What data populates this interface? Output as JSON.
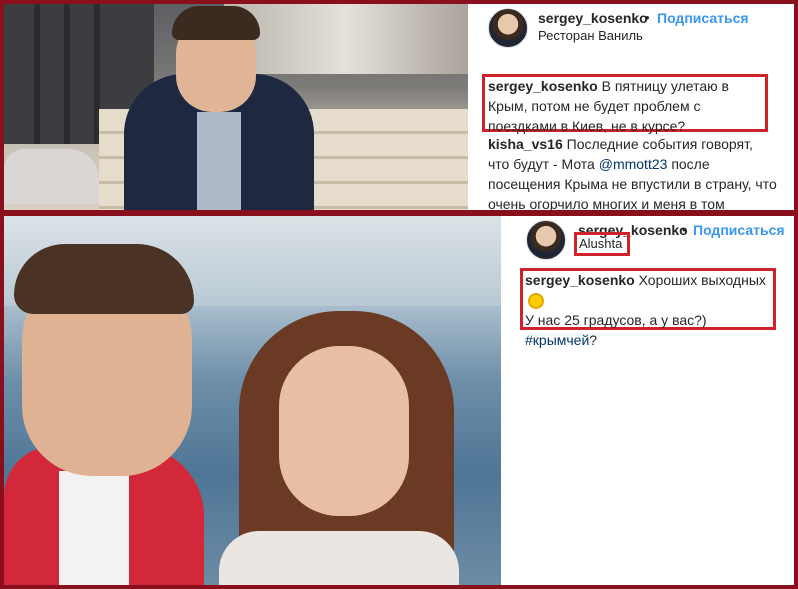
{
  "post1": {
    "username": "sergey_kosenko",
    "separator": "•",
    "follow_label": "Подписаться",
    "location": "Ресторан Ваниль",
    "caption_user": "sergey_kosenko",
    "caption_text": "В пятницу улетаю в Крым, потом не будет проблем с поездками в Киев, не в курсе?",
    "comment_user": "kisha_vs16",
    "comment_text_before": "Последние события говорят, что будут - Мота",
    "comment_mention": "@mmott23",
    "comment_text_after": "после посещения Крыма не впустили в страну, что очень огорчило многих и меня в том"
  },
  "post2": {
    "username": "sergey_kosenko",
    "separator": "•",
    "follow_label": "Подписаться",
    "location": "Alushta",
    "caption_user": "sergey_kosenko",
    "caption_text": "Хороших выходных",
    "caption_line2": "У нас 25 градусов, а у вас?)",
    "caption_hashtag": "#крымчей",
    "caption_end": "?"
  },
  "colors": {
    "frame": "#8a0f1c",
    "highlight": "#d0222a",
    "follow": "#3897f0",
    "link": "#003569"
  }
}
